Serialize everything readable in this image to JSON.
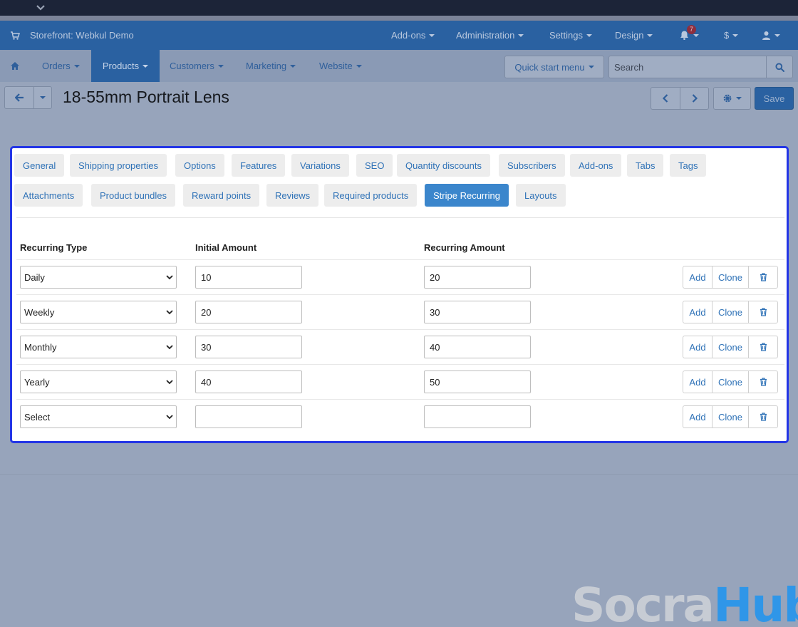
{
  "colors": {
    "accent": "#2a61a1",
    "tab_active": "#3b86cc",
    "panel_outline": "#2335e6",
    "link": "#2f72b7"
  },
  "navbar_top": {
    "brand": "Storefront: Webkul Demo",
    "items": [
      "Add-ons",
      "Administration",
      "Settings",
      "Design"
    ],
    "notification_count": "7",
    "currency": "$",
    "icons": {
      "cart": "cart-icon",
      "bell": "bell-icon",
      "user": "user-icon"
    }
  },
  "navbar_main": {
    "items": [
      "Orders",
      "Products",
      "Customers",
      "Marketing",
      "Website"
    ],
    "active": "Products",
    "quick_start": "Quick start menu",
    "search_placeholder": "Search"
  },
  "toolbar": {
    "title": "18-55mm Portrait Lens",
    "save_label": "Save"
  },
  "tabs": {
    "row1": [
      "General",
      "Shipping properties",
      "Options",
      "Features",
      "Variations",
      "SEO",
      "Quantity discounts",
      "Subscribers",
      "Add-ons",
      "Tabs",
      "Tags"
    ],
    "row2": [
      "Attachments",
      "Product bundles",
      "Reward points",
      "Reviews",
      "Required products",
      "Stripe Recurring",
      "Layouts"
    ],
    "active": "Stripe Recurring"
  },
  "recurring_table": {
    "headers": {
      "type": "Recurring Type",
      "initial": "Initial Amount",
      "recurring": "Recurring Amount"
    },
    "rows": [
      {
        "type": "Daily",
        "initial": "10",
        "recurring": "20"
      },
      {
        "type": "Weekly",
        "initial": "20",
        "recurring": "30"
      },
      {
        "type": "Monthly",
        "initial": "30",
        "recurring": "40"
      },
      {
        "type": "Yearly",
        "initial": "40",
        "recurring": "50"
      },
      {
        "type": "Select",
        "initial": "",
        "recurring": ""
      }
    ],
    "actions": {
      "add": "Add",
      "clone": "Clone",
      "delete_icon": "trash-icon"
    }
  },
  "watermark": {
    "part1": "Socra",
    "part2": "Hub"
  }
}
